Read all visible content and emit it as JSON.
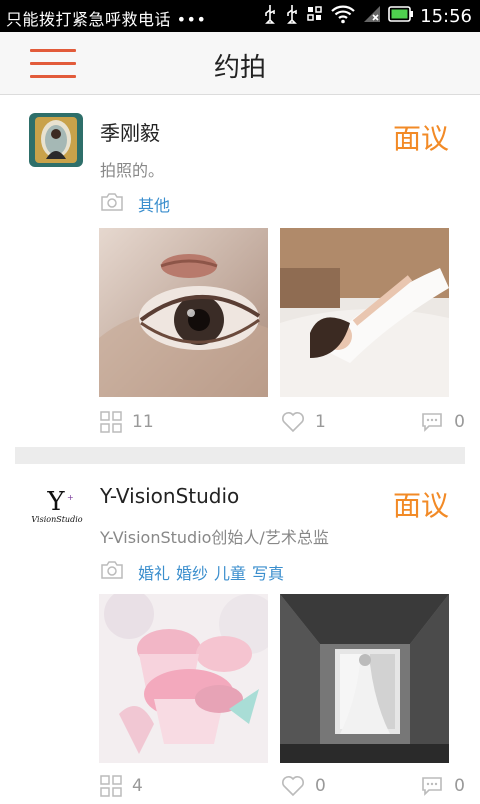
{
  "statusbar": {
    "notification": "只能拨打紧急呼救电话 •••",
    "time": "15:56",
    "icons": [
      "usb-icon",
      "usb-icon",
      "sim-icon",
      "wifi-icon",
      "signal-icon",
      "battery-icon"
    ]
  },
  "appbar": {
    "menu_icon": "hamburger-menu-icon",
    "title": "约拍"
  },
  "colors": {
    "accent": "#e25b3a",
    "price": "#f28a26",
    "tag": "#3a8ecd"
  },
  "posts": [
    {
      "name": "季刚毅",
      "price": "面议",
      "desc": "拍照的。",
      "tags": [
        "其他"
      ],
      "stats": {
        "albums": "11",
        "likes": "1",
        "comments": "0"
      }
    },
    {
      "name": "Y-VisionStudio",
      "avatar_text": "Y",
      "avatar_subtext": "VisionStudio",
      "price": "面议",
      "desc": "Y-VisionStudio创始人/艺术总监",
      "tags": [
        "婚礼",
        "婚纱",
        "儿童",
        "写真"
      ],
      "stats": {
        "albums": "4",
        "likes": "0",
        "comments": "0"
      }
    }
  ]
}
